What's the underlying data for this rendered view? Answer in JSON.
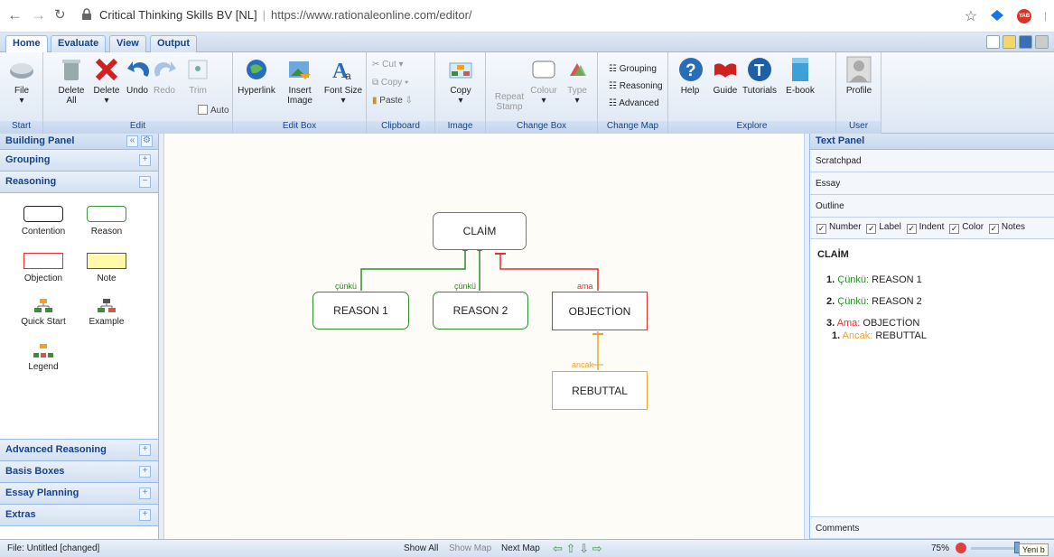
{
  "browser": {
    "site": "Critical Thinking Skills BV [NL]",
    "url": "https://www.rationaleonline.com/editor/",
    "badge": "YAB"
  },
  "tabs": [
    "Home",
    "Evaluate",
    "View",
    "Output"
  ],
  "ribbon": {
    "start": {
      "file": "File",
      "group": "Start"
    },
    "edit": {
      "delete_all": "Delete All",
      "delete": "Delete",
      "undo": "Undo",
      "redo": "Redo",
      "trim": "Trim",
      "auto": "Auto",
      "group": "Edit"
    },
    "editbox": {
      "hyperlink": "Hyperlink",
      "insert_image": "Insert Image",
      "font_size": "Font Size",
      "group": "Edit Box"
    },
    "clipboard": {
      "cut": "Cut",
      "copy": "Copy",
      "paste": "Paste",
      "group": "Clipboard"
    },
    "image": {
      "copy": "Copy",
      "group": "Image"
    },
    "changebox": {
      "repeat_stamp": "Repeat Stamp",
      "colour": "Colour",
      "type": "Type",
      "group": "Change Box"
    },
    "changemap": {
      "grouping": "Grouping",
      "reasoning": "Reasoning",
      "advanced": "Advanced",
      "group": "Change Map"
    },
    "explore": {
      "help": "Help",
      "guide": "Guide",
      "tutorials": "Tutorials",
      "ebook": "E-book",
      "group": "Explore"
    },
    "user": {
      "profile": "Profile",
      "group": "User"
    }
  },
  "left": {
    "title": "Building Panel",
    "grouping": "Grouping",
    "reasoning": "Reasoning",
    "palette": {
      "contention": "Contention",
      "reason": "Reason",
      "objection": "Objection",
      "note": "Note",
      "quick_start": "Quick Start",
      "example": "Example",
      "legend": "Legend"
    },
    "advanced": "Advanced Reasoning",
    "basis": "Basis Boxes",
    "essay": "Essay Planning",
    "extras": "Extras"
  },
  "map": {
    "claim": "CLAİM",
    "reason1": "REASON 1",
    "reason2": "REASON 2",
    "objection": "OBJECTİON",
    "rebuttal": "REBUTTAL",
    "lbl_because1": "çünkü",
    "lbl_because2": "çünkü",
    "lbl_but": "ama",
    "lbl_however": "ancak"
  },
  "colors": {
    "reason": "#2e8b2e",
    "objection": "#e03030",
    "rebuttal": "#f0a030"
  },
  "right": {
    "title": "Text Panel",
    "scratchpad": "Scratchpad",
    "essay": "Essay",
    "outline": "Outline",
    "checks": [
      "Number",
      "Label",
      "Indent",
      "Color",
      "Notes"
    ],
    "claim": "CLAİM",
    "items": [
      {
        "num": "1.",
        "kw": "Çünkü:",
        "text": "REASON 1"
      },
      {
        "num": "2.",
        "kw": "Çünkü:",
        "text": "REASON 2"
      },
      {
        "num": "3.",
        "kw": "Ama:",
        "text": "OBJECTİON"
      }
    ],
    "sub": {
      "num": "1.",
      "kw": "Ancak:",
      "text": "REBUTTAL"
    },
    "comments": "Comments"
  },
  "status": {
    "file": "File: Untitled [changed]",
    "show_all": "Show All",
    "show_map": "Show Map",
    "next_map": "Next Map",
    "zoom": "75%",
    "tooltip": "Yeni b"
  }
}
